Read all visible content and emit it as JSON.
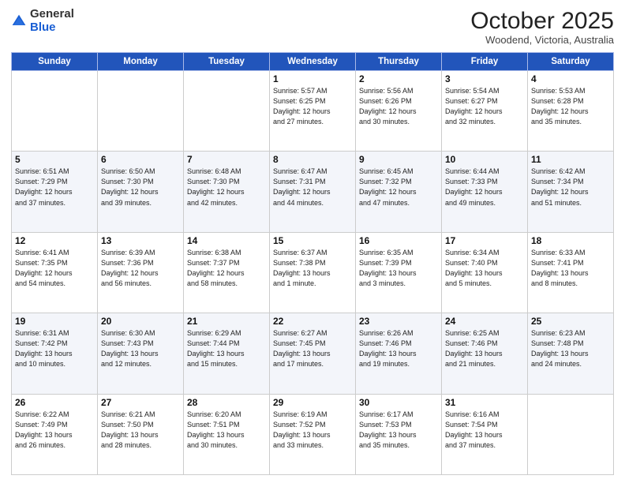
{
  "header": {
    "logo": {
      "line1": "General",
      "line2": "Blue"
    },
    "title": "October 2025",
    "subtitle": "Woodend, Victoria, Australia"
  },
  "weekdays": [
    "Sunday",
    "Monday",
    "Tuesday",
    "Wednesday",
    "Thursday",
    "Friday",
    "Saturday"
  ],
  "weeks": [
    {
      "days": [
        {
          "num": "",
          "info": ""
        },
        {
          "num": "",
          "info": ""
        },
        {
          "num": "",
          "info": ""
        },
        {
          "num": "1",
          "info": "Sunrise: 5:57 AM\nSunset: 6:25 PM\nDaylight: 12 hours\nand 27 minutes."
        },
        {
          "num": "2",
          "info": "Sunrise: 5:56 AM\nSunset: 6:26 PM\nDaylight: 12 hours\nand 30 minutes."
        },
        {
          "num": "3",
          "info": "Sunrise: 5:54 AM\nSunset: 6:27 PM\nDaylight: 12 hours\nand 32 minutes."
        },
        {
          "num": "4",
          "info": "Sunrise: 5:53 AM\nSunset: 6:28 PM\nDaylight: 12 hours\nand 35 minutes."
        }
      ]
    },
    {
      "days": [
        {
          "num": "5",
          "info": "Sunrise: 6:51 AM\nSunset: 7:29 PM\nDaylight: 12 hours\nand 37 minutes."
        },
        {
          "num": "6",
          "info": "Sunrise: 6:50 AM\nSunset: 7:30 PM\nDaylight: 12 hours\nand 39 minutes."
        },
        {
          "num": "7",
          "info": "Sunrise: 6:48 AM\nSunset: 7:30 PM\nDaylight: 12 hours\nand 42 minutes."
        },
        {
          "num": "8",
          "info": "Sunrise: 6:47 AM\nSunset: 7:31 PM\nDaylight: 12 hours\nand 44 minutes."
        },
        {
          "num": "9",
          "info": "Sunrise: 6:45 AM\nSunset: 7:32 PM\nDaylight: 12 hours\nand 47 minutes."
        },
        {
          "num": "10",
          "info": "Sunrise: 6:44 AM\nSunset: 7:33 PM\nDaylight: 12 hours\nand 49 minutes."
        },
        {
          "num": "11",
          "info": "Sunrise: 6:42 AM\nSunset: 7:34 PM\nDaylight: 12 hours\nand 51 minutes."
        }
      ]
    },
    {
      "days": [
        {
          "num": "12",
          "info": "Sunrise: 6:41 AM\nSunset: 7:35 PM\nDaylight: 12 hours\nand 54 minutes."
        },
        {
          "num": "13",
          "info": "Sunrise: 6:39 AM\nSunset: 7:36 PM\nDaylight: 12 hours\nand 56 minutes."
        },
        {
          "num": "14",
          "info": "Sunrise: 6:38 AM\nSunset: 7:37 PM\nDaylight: 12 hours\nand 58 minutes."
        },
        {
          "num": "15",
          "info": "Sunrise: 6:37 AM\nSunset: 7:38 PM\nDaylight: 13 hours\nand 1 minute."
        },
        {
          "num": "16",
          "info": "Sunrise: 6:35 AM\nSunset: 7:39 PM\nDaylight: 13 hours\nand 3 minutes."
        },
        {
          "num": "17",
          "info": "Sunrise: 6:34 AM\nSunset: 7:40 PM\nDaylight: 13 hours\nand 5 minutes."
        },
        {
          "num": "18",
          "info": "Sunrise: 6:33 AM\nSunset: 7:41 PM\nDaylight: 13 hours\nand 8 minutes."
        }
      ]
    },
    {
      "days": [
        {
          "num": "19",
          "info": "Sunrise: 6:31 AM\nSunset: 7:42 PM\nDaylight: 13 hours\nand 10 minutes."
        },
        {
          "num": "20",
          "info": "Sunrise: 6:30 AM\nSunset: 7:43 PM\nDaylight: 13 hours\nand 12 minutes."
        },
        {
          "num": "21",
          "info": "Sunrise: 6:29 AM\nSunset: 7:44 PM\nDaylight: 13 hours\nand 15 minutes."
        },
        {
          "num": "22",
          "info": "Sunrise: 6:27 AM\nSunset: 7:45 PM\nDaylight: 13 hours\nand 17 minutes."
        },
        {
          "num": "23",
          "info": "Sunrise: 6:26 AM\nSunset: 7:46 PM\nDaylight: 13 hours\nand 19 minutes."
        },
        {
          "num": "24",
          "info": "Sunrise: 6:25 AM\nSunset: 7:46 PM\nDaylight: 13 hours\nand 21 minutes."
        },
        {
          "num": "25",
          "info": "Sunrise: 6:23 AM\nSunset: 7:48 PM\nDaylight: 13 hours\nand 24 minutes."
        }
      ]
    },
    {
      "days": [
        {
          "num": "26",
          "info": "Sunrise: 6:22 AM\nSunset: 7:49 PM\nDaylight: 13 hours\nand 26 minutes."
        },
        {
          "num": "27",
          "info": "Sunrise: 6:21 AM\nSunset: 7:50 PM\nDaylight: 13 hours\nand 28 minutes."
        },
        {
          "num": "28",
          "info": "Sunrise: 6:20 AM\nSunset: 7:51 PM\nDaylight: 13 hours\nand 30 minutes."
        },
        {
          "num": "29",
          "info": "Sunrise: 6:19 AM\nSunset: 7:52 PM\nDaylight: 13 hours\nand 33 minutes."
        },
        {
          "num": "30",
          "info": "Sunrise: 6:17 AM\nSunset: 7:53 PM\nDaylight: 13 hours\nand 35 minutes."
        },
        {
          "num": "31",
          "info": "Sunrise: 6:16 AM\nSunset: 7:54 PM\nDaylight: 13 hours\nand 37 minutes."
        },
        {
          "num": "",
          "info": ""
        }
      ]
    }
  ]
}
